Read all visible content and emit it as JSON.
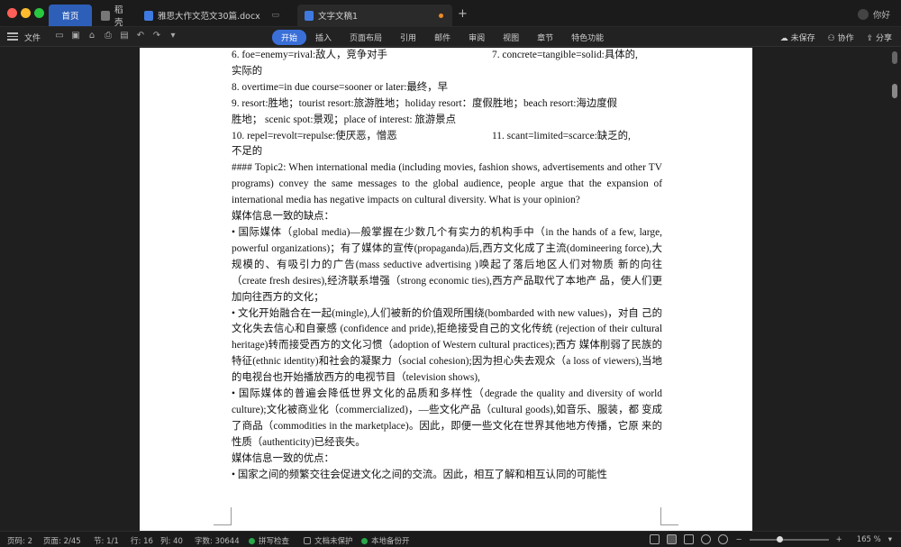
{
  "tabs": {
    "home": "首页",
    "daoke": "稻壳",
    "docx": "雅思大作文范文30篇.docx",
    "doc1": "文字文稿1",
    "new_tab": "+"
  },
  "user": {
    "greeting": "你好"
  },
  "toolbar": {
    "file": "文件",
    "ribbon": [
      "开始",
      "插入",
      "页面布局",
      "引用",
      "邮件",
      "审阅",
      "视图",
      "章节",
      "特色功能"
    ],
    "unsaved": "未保存",
    "collab": "协作",
    "share": "分享"
  },
  "doc": {
    "l1a": "6. foe=enemy=rival:敌人，竞争对手",
    "l1b": "7. concrete=tangible=solid:具体的,",
    "l2": "实际的",
    "l3": "8. overtime=in due course=sooner or later:最终，早",
    "l4": "9. resort:胜地；tourist resort:旅游胜地；holiday resort：度假胜地；beach resort:海边度假",
    "l5": "胜地；  scenic spot:景观；place of interest:        旅游景点",
    "l6a": "10. repel=revolt=repulse:使厌恶，憎恶",
    "l6b": "11. scant=limited=scarce:缺乏的,",
    "l7": "不足的",
    "p_topic": "#### Topic2: When international media (including movies, fashion shows, advertisements and other TV programs) convey the same messages to the global audience, people argue that the expansion of international media has negative impacts on cultural diversity. What is your opinion?",
    "h_cons": "媒体信息一致的缺点：",
    "p_b1": "• 国际媒体（global media)—般掌握在少数几个有实力的机构手中（in the hands of a few, large, powerful organizations)；有了媒体的宣传(propaganda)后,西方文化成了主流(domineering force),大规模的、有吸引力的广告(mass seductive advertising )唤起了落后地区人们对物质 新的向往（create fresh desires),经济联系增强（strong economic ties),西方产品取代了本地产 品，使人们更加向往西方的文化；",
    "p_b2": "• 文化开始融合在一起(mingle),人们被新的价值观所围绕(bombarded with new values)，对自 己的文化失去信心和自豪感 (confidence and pride),拒绝接受自己的文化传统 (rejection of their cultural heritage)转而接受西方的文化习惯（adoption of Western cultural practices);西方  媒体削弱了民族的特征(ethnic identity)和社会的凝聚力（social cohesion);因为担心失去观众（a loss of viewers),当地的电视台也开始播放西方的电视节目（television shows),",
    "p_b3": "• 国际媒体的普遍会降低世界文化的品质和多样性（degrade the quality and diversity of world culture);文化被商业化（commercialized)，—些文化产品（cultural goods),如音乐、服装，都 变成了商品（commodities in the marketplace)。因此，即便一些文化在世界其他地方传播，它原 来的性质（authenticity)已经丧失。",
    "h_pros": "媒体信息一致的优点：",
    "p_b4": "• 国家之间的频繁交往会促进文化之间的交流。因此，相互了解和相互认同的可能性"
  },
  "status": {
    "page_no": "页码: 2",
    "pages": "页面: 2/45",
    "section": "节: 1/1",
    "line": "行: 16",
    "col": "列: 40",
    "words": "字数: 30644",
    "spell": "拼写检查",
    "protect": "文档未保护",
    "backup": "本地备份开",
    "zoom": "165 %",
    "zoom_minus": "−",
    "zoom_plus": "+"
  },
  "zoom_level": 0.39,
  "colors": {
    "accent": "#3a6fd8",
    "tab_active": "#2e5fb8",
    "modified_dot": "#f08a24",
    "status_ok": "#2aa84a"
  }
}
